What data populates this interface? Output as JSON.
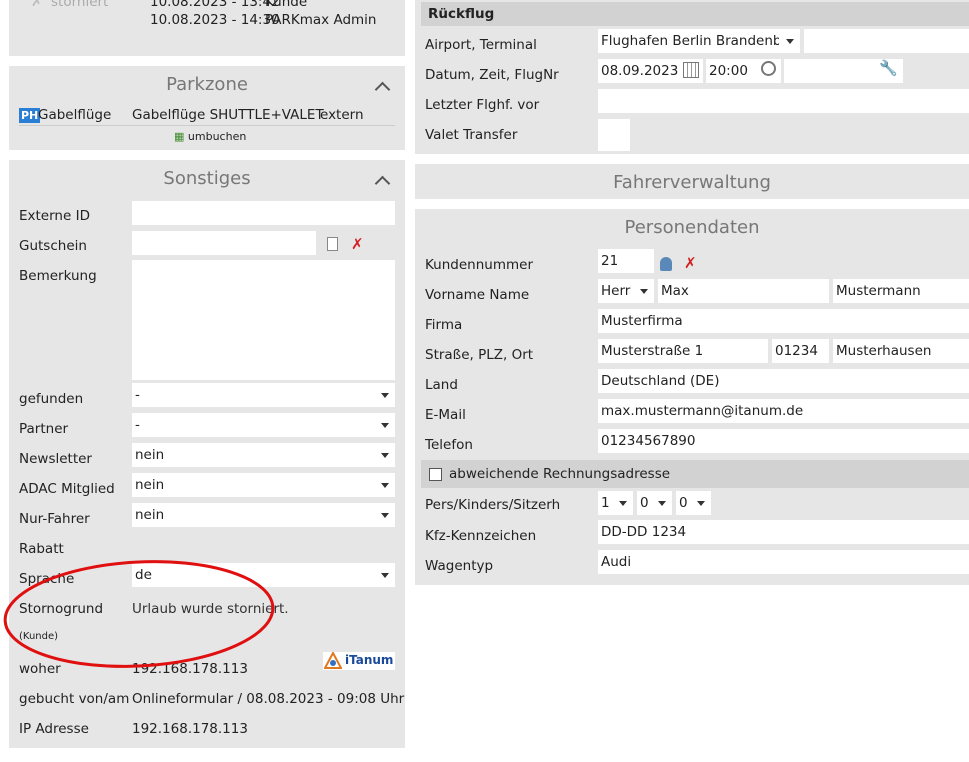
{
  "left": {
    "top_strip": {
      "status": "storniert",
      "row1_date": "10.08.2023 - 13:42",
      "row1_by": "Kunde",
      "row2_date": "10.08.2023 - 14:30",
      "row2_by": "PARKmax Admin"
    },
    "parkzone": {
      "title": "Parkzone",
      "badge": "PH",
      "name": "Gabelflüge",
      "product": "Gabelflüge SHUTTLE+VALET",
      "type": "extern",
      "rebook": "umbuchen"
    },
    "sonstiges": {
      "title": "Sonstiges",
      "externe_id": {
        "label": "Externe ID",
        "value": ""
      },
      "gutschein": {
        "label": "Gutschein",
        "value": ""
      },
      "bemerkung": {
        "label": "Bemerkung",
        "value": ""
      },
      "gefunden": {
        "label": "gefunden",
        "value": "-"
      },
      "partner": {
        "label": "Partner",
        "value": "-"
      },
      "newsletter": {
        "label": "Newsletter",
        "value": "nein"
      },
      "adac": {
        "label": "ADAC Mitglied",
        "value": "nein"
      },
      "nur_fahrer": {
        "label": "Nur-Fahrer",
        "value": "nein"
      },
      "rabatt": {
        "label": "Rabatt"
      },
      "sprache": {
        "label": "Sprache",
        "value": "de"
      },
      "stornogrund": {
        "label": "Stornogrund",
        "sub": "(Kunde)",
        "value": "Urlaub wurde storniert."
      },
      "woher": {
        "label": "woher",
        "value": "192.168.178.113"
      },
      "gebucht": {
        "label": "gebucht von/am",
        "value": "Onlineformular / 08.08.2023 - 09:08 Uhr"
      },
      "ip": {
        "label": "IP Adresse",
        "value": "192.168.178.113"
      },
      "logo_text": "iTanum"
    }
  },
  "right": {
    "rueckflug": {
      "title": "Rückflug",
      "airport": {
        "label": "Airport, Terminal",
        "value": "Flughafen Berlin Brandenbu"
      },
      "datum": {
        "label": "Datum, Zeit, FlugNr",
        "date": "08.09.2023",
        "time": "20:00",
        "flight": ""
      },
      "letzter": {
        "label": "Letzter Flghf. vor",
        "value": ""
      },
      "valet": {
        "label": "Valet Transfer"
      }
    },
    "fahrerverwaltung": {
      "title": "Fahrerverwaltung"
    },
    "personendaten": {
      "title": "Personendaten",
      "kundennummer": {
        "label": "Kundennummer",
        "value": "21"
      },
      "name": {
        "label": "Vorname Name",
        "anrede": "Herr",
        "vorname": "Max",
        "nachname": "Mustermann"
      },
      "firma": {
        "label": "Firma",
        "value": "Musterfirma"
      },
      "adresse": {
        "label": "Straße, PLZ, Ort",
        "strasse": "Musterstraße 1",
        "plz": "01234",
        "ort": "Musterhausen"
      },
      "land": {
        "label": "Land",
        "value": "Deutschland (DE)"
      },
      "email": {
        "label": "E-Mail",
        "value": "max.mustermann@itanum.de"
      },
      "telefon": {
        "label": "Telefon",
        "value": "01234567890"
      },
      "abweichend": {
        "label": "abweichende Rechnungsadresse",
        "checked": false
      },
      "pers": {
        "label": "Pers/Kinders/Sitzerh",
        "pers": "1",
        "kinder": "0",
        "sitz": "0"
      },
      "kfz": {
        "label": "Kfz-Kennzeichen",
        "value": "DD-DD 1234"
      },
      "wagentyp": {
        "label": "Wagentyp",
        "value": "Audi"
      }
    }
  },
  "colors": {
    "panel": "#e6e6e6",
    "annotation": "#e01010",
    "badge": "#2a7fd4"
  }
}
